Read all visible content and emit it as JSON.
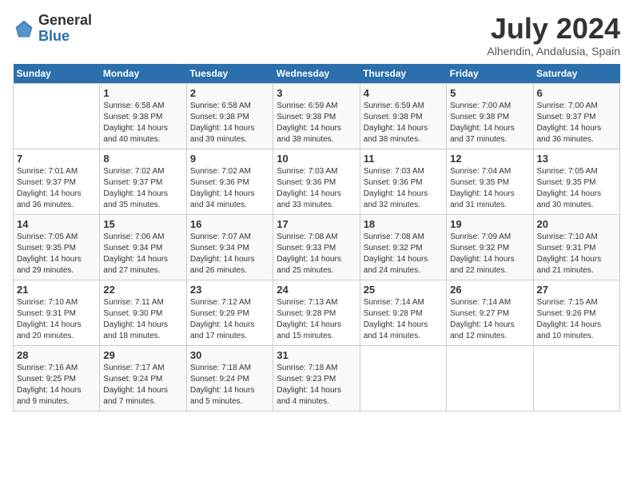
{
  "header": {
    "logo_general": "General",
    "logo_blue": "Blue",
    "month_year": "July 2024",
    "location": "Alhendin, Andalusia, Spain"
  },
  "days_of_week": [
    "Sunday",
    "Monday",
    "Tuesday",
    "Wednesday",
    "Thursday",
    "Friday",
    "Saturday"
  ],
  "weeks": [
    [
      {
        "day": "",
        "sunrise": "",
        "sunset": "",
        "daylight": ""
      },
      {
        "day": "1",
        "sunrise": "Sunrise: 6:58 AM",
        "sunset": "Sunset: 9:38 PM",
        "daylight": "Daylight: 14 hours and 40 minutes."
      },
      {
        "day": "2",
        "sunrise": "Sunrise: 6:58 AM",
        "sunset": "Sunset: 9:38 PM",
        "daylight": "Daylight: 14 hours and 39 minutes."
      },
      {
        "day": "3",
        "sunrise": "Sunrise: 6:59 AM",
        "sunset": "Sunset: 9:38 PM",
        "daylight": "Daylight: 14 hours and 38 minutes."
      },
      {
        "day": "4",
        "sunrise": "Sunrise: 6:59 AM",
        "sunset": "Sunset: 9:38 PM",
        "daylight": "Daylight: 14 hours and 38 minutes."
      },
      {
        "day": "5",
        "sunrise": "Sunrise: 7:00 AM",
        "sunset": "Sunset: 9:38 PM",
        "daylight": "Daylight: 14 hours and 37 minutes."
      },
      {
        "day": "6",
        "sunrise": "Sunrise: 7:00 AM",
        "sunset": "Sunset: 9:37 PM",
        "daylight": "Daylight: 14 hours and 36 minutes."
      }
    ],
    [
      {
        "day": "7",
        "sunrise": "Sunrise: 7:01 AM",
        "sunset": "Sunset: 9:37 PM",
        "daylight": "Daylight: 14 hours and 36 minutes."
      },
      {
        "day": "8",
        "sunrise": "Sunrise: 7:02 AM",
        "sunset": "Sunset: 9:37 PM",
        "daylight": "Daylight: 14 hours and 35 minutes."
      },
      {
        "day": "9",
        "sunrise": "Sunrise: 7:02 AM",
        "sunset": "Sunset: 9:36 PM",
        "daylight": "Daylight: 14 hours and 34 minutes."
      },
      {
        "day": "10",
        "sunrise": "Sunrise: 7:03 AM",
        "sunset": "Sunset: 9:36 PM",
        "daylight": "Daylight: 14 hours and 33 minutes."
      },
      {
        "day": "11",
        "sunrise": "Sunrise: 7:03 AM",
        "sunset": "Sunset: 9:36 PM",
        "daylight": "Daylight: 14 hours and 32 minutes."
      },
      {
        "day": "12",
        "sunrise": "Sunrise: 7:04 AM",
        "sunset": "Sunset: 9:35 PM",
        "daylight": "Daylight: 14 hours and 31 minutes."
      },
      {
        "day": "13",
        "sunrise": "Sunrise: 7:05 AM",
        "sunset": "Sunset: 9:35 PM",
        "daylight": "Daylight: 14 hours and 30 minutes."
      }
    ],
    [
      {
        "day": "14",
        "sunrise": "Sunrise: 7:05 AM",
        "sunset": "Sunset: 9:35 PM",
        "daylight": "Daylight: 14 hours and 29 minutes."
      },
      {
        "day": "15",
        "sunrise": "Sunrise: 7:06 AM",
        "sunset": "Sunset: 9:34 PM",
        "daylight": "Daylight: 14 hours and 27 minutes."
      },
      {
        "day": "16",
        "sunrise": "Sunrise: 7:07 AM",
        "sunset": "Sunset: 9:34 PM",
        "daylight": "Daylight: 14 hours and 26 minutes."
      },
      {
        "day": "17",
        "sunrise": "Sunrise: 7:08 AM",
        "sunset": "Sunset: 9:33 PM",
        "daylight": "Daylight: 14 hours and 25 minutes."
      },
      {
        "day": "18",
        "sunrise": "Sunrise: 7:08 AM",
        "sunset": "Sunset: 9:32 PM",
        "daylight": "Daylight: 14 hours and 24 minutes."
      },
      {
        "day": "19",
        "sunrise": "Sunrise: 7:09 AM",
        "sunset": "Sunset: 9:32 PM",
        "daylight": "Daylight: 14 hours and 22 minutes."
      },
      {
        "day": "20",
        "sunrise": "Sunrise: 7:10 AM",
        "sunset": "Sunset: 9:31 PM",
        "daylight": "Daylight: 14 hours and 21 minutes."
      }
    ],
    [
      {
        "day": "21",
        "sunrise": "Sunrise: 7:10 AM",
        "sunset": "Sunset: 9:31 PM",
        "daylight": "Daylight: 14 hours and 20 minutes."
      },
      {
        "day": "22",
        "sunrise": "Sunrise: 7:11 AM",
        "sunset": "Sunset: 9:30 PM",
        "daylight": "Daylight: 14 hours and 18 minutes."
      },
      {
        "day": "23",
        "sunrise": "Sunrise: 7:12 AM",
        "sunset": "Sunset: 9:29 PM",
        "daylight": "Daylight: 14 hours and 17 minutes."
      },
      {
        "day": "24",
        "sunrise": "Sunrise: 7:13 AM",
        "sunset": "Sunset: 9:28 PM",
        "daylight": "Daylight: 14 hours and 15 minutes."
      },
      {
        "day": "25",
        "sunrise": "Sunrise: 7:14 AM",
        "sunset": "Sunset: 9:28 PM",
        "daylight": "Daylight: 14 hours and 14 minutes."
      },
      {
        "day": "26",
        "sunrise": "Sunrise: 7:14 AM",
        "sunset": "Sunset: 9:27 PM",
        "daylight": "Daylight: 14 hours and 12 minutes."
      },
      {
        "day": "27",
        "sunrise": "Sunrise: 7:15 AM",
        "sunset": "Sunset: 9:26 PM",
        "daylight": "Daylight: 14 hours and 10 minutes."
      }
    ],
    [
      {
        "day": "28",
        "sunrise": "Sunrise: 7:16 AM",
        "sunset": "Sunset: 9:25 PM",
        "daylight": "Daylight: 14 hours and 9 minutes."
      },
      {
        "day": "29",
        "sunrise": "Sunrise: 7:17 AM",
        "sunset": "Sunset: 9:24 PM",
        "daylight": "Daylight: 14 hours and 7 minutes."
      },
      {
        "day": "30",
        "sunrise": "Sunrise: 7:18 AM",
        "sunset": "Sunset: 9:24 PM",
        "daylight": "Daylight: 14 hours and 5 minutes."
      },
      {
        "day": "31",
        "sunrise": "Sunrise: 7:18 AM",
        "sunset": "Sunset: 9:23 PM",
        "daylight": "Daylight: 14 hours and 4 minutes."
      },
      {
        "day": "",
        "sunrise": "",
        "sunset": "",
        "daylight": ""
      },
      {
        "day": "",
        "sunrise": "",
        "sunset": "",
        "daylight": ""
      },
      {
        "day": "",
        "sunrise": "",
        "sunset": "",
        "daylight": ""
      }
    ]
  ]
}
